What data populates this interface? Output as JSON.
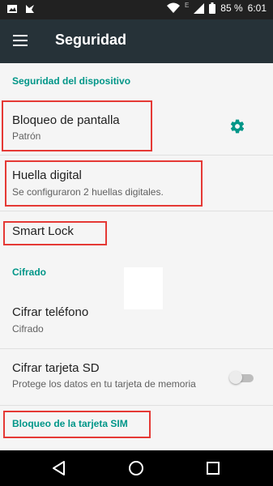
{
  "status_bar": {
    "left_icons": [
      "picture-icon",
      "flag-icon"
    ],
    "right_icons": [
      "wifi-icon",
      "network-e-icon",
      "signal-icon",
      "battery-icon"
    ],
    "network_type": "E",
    "battery": "85 %",
    "time": "6:01"
  },
  "app_bar": {
    "title": "Seguridad"
  },
  "sections": {
    "device": "Seguridad del dispositivo",
    "encryption": "Cifrado",
    "sim": "Bloqueo de la tarjeta SIM"
  },
  "items": {
    "screen_lock": {
      "title": "Bloqueo de pantalla",
      "subtitle": "Patrón"
    },
    "fingerprint": {
      "title": "Huella digital",
      "subtitle": "Se configuraron 2 huellas digitales."
    },
    "smart_lock": {
      "title": "Smart Lock"
    },
    "encrypt_phone": {
      "title": "Cifrar teléfono",
      "subtitle": "Cifrado"
    },
    "encrypt_sd": {
      "title": "Cifrar tarjeta SD",
      "subtitle": "Protege los datos en tu tarjeta de memoria",
      "toggle_on": false
    }
  },
  "colors": {
    "status_bar": "#212121",
    "app_bar": "#263238",
    "accent": "#009688",
    "highlight": "#e53935",
    "background": "#f5f5f5"
  }
}
